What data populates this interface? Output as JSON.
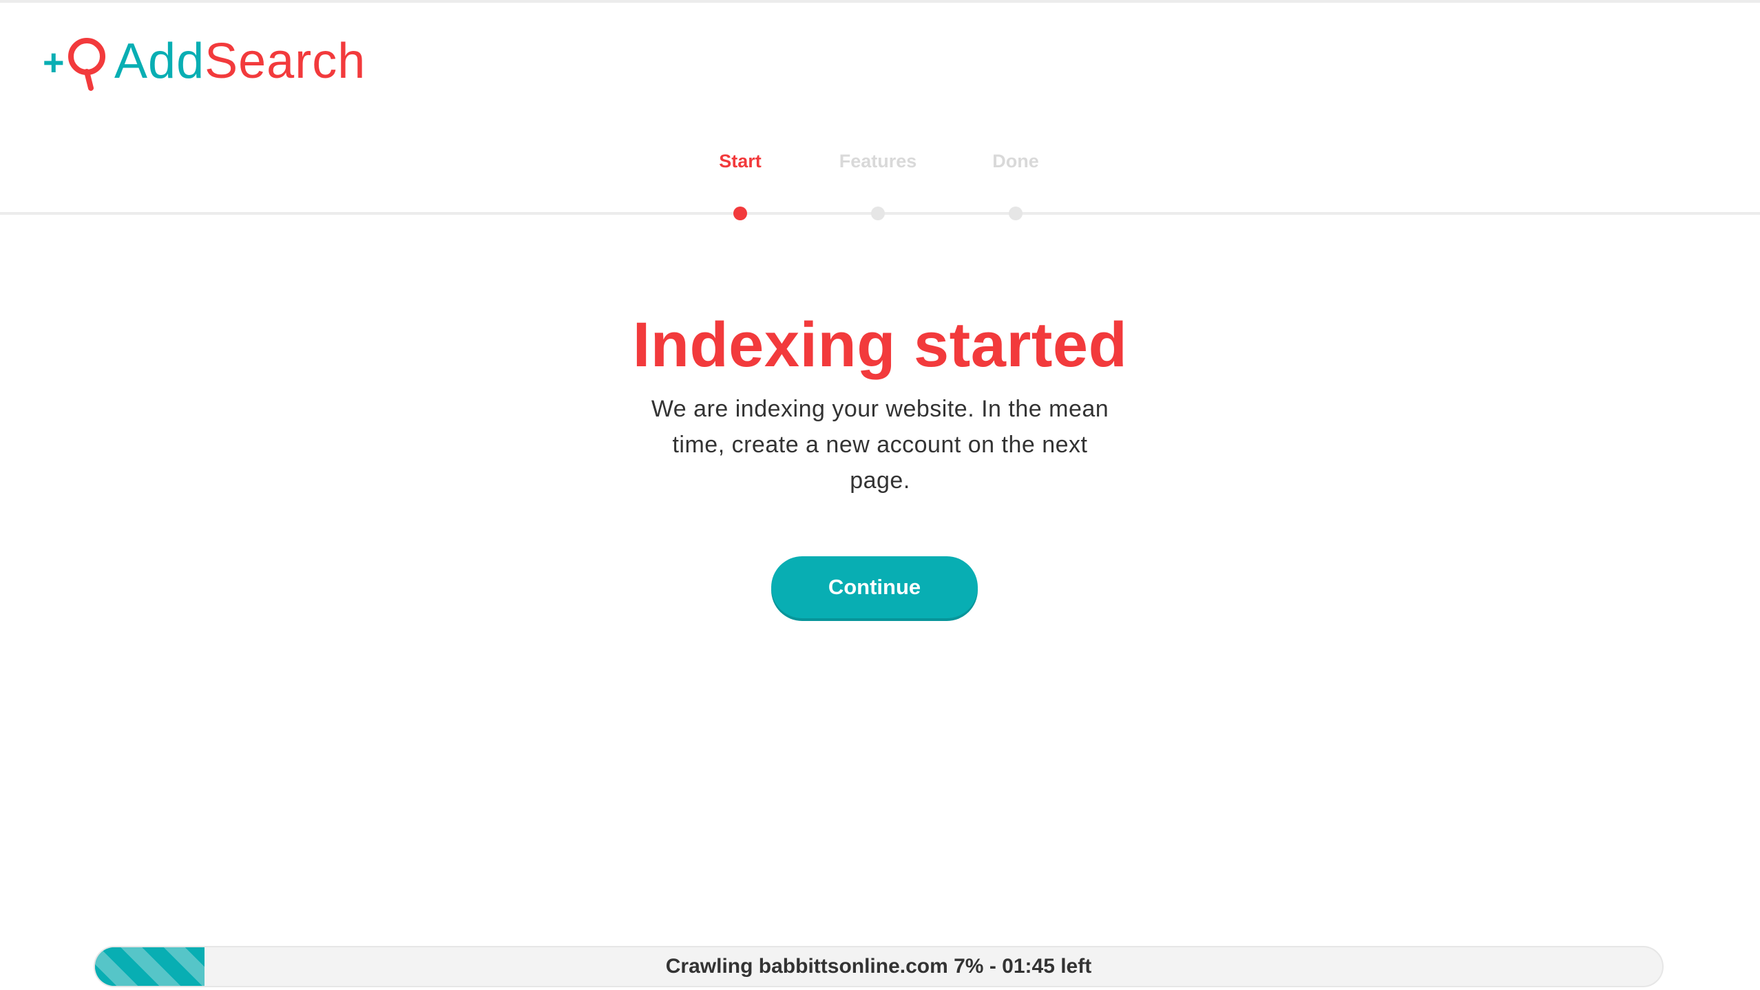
{
  "brand": {
    "logo_add": "Add",
    "logo_search": "Search",
    "teal": "#08aeb3",
    "red": "#f23a3c"
  },
  "steps": [
    {
      "label": "Start",
      "active": true
    },
    {
      "label": "Features",
      "active": false
    },
    {
      "label": "Done",
      "active": false
    }
  ],
  "main": {
    "title": "Indexing started",
    "description": "We are indexing your website. In the mean time, create a new account on the next page.",
    "continue_label": "Continue"
  },
  "crawl": {
    "status_text": "Crawling babbittsonline.com 7% - 01:45 left",
    "progress_fraction": 0.07
  }
}
